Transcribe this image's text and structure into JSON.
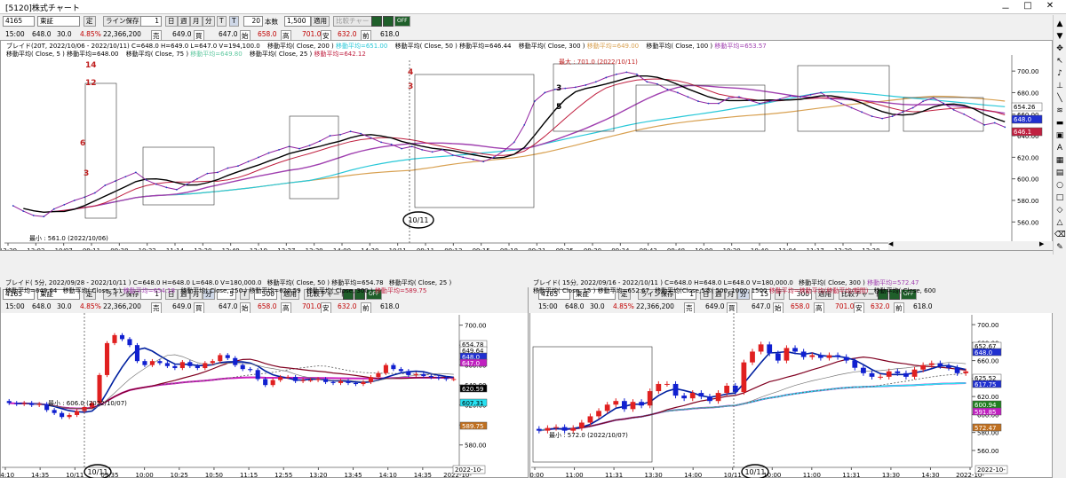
{
  "window": {
    "title": "[5120]株式チャート",
    "minimize": "－",
    "restore": "□",
    "close": "✕"
  },
  "toolbar_icons": [
    "gear-icon",
    "scale-icon",
    "off-icon"
  ],
  "top": {
    "toolbar": {
      "code": "4165",
      "market": "東証",
      "period": "定",
      "line_save": "ライン保存",
      "num1": "1",
      "unit1": "日",
      "unit2": "週",
      "unit3": "月",
      "unit4": "分",
      "btn_t1": "T",
      "btn_t2": "T",
      "bars": "20",
      "candles": "本数",
      "count": "1,500",
      "apply": "適用",
      "compare": "比較チャート",
      "time": "15:00",
      "price": "648.0",
      "diff": "30.0",
      "pct": "4.85%",
      "volume": "22,366,200",
      "sell_lbl": "売",
      "ask": "649.0",
      "buy_lbl": "買",
      "open": "647.0",
      "open_lbl": "始",
      "high": "658.0",
      "high_lbl": "高",
      "low": "701.0",
      "low_lbl": "安",
      "pclose": "632.0",
      "prev_lbl": "前",
      "last": "618.0"
    },
    "legend": [
      "ブレイド(20T, 2022/10/06 - 2022/10/11) C=648.0 H=649.0 L=647.0 V=194,100.0",
      "移動平均( Close, 200 )",
      "移動平均=651.00",
      "移動平均( Close, 50 )",
      "移動平均=646.44",
      "移動平均( Close, 300 )",
      "移動平均=649.00",
      "移動平均( Close, 100 )",
      "移動平均=653.57",
      "移動平均( Close, 5 )",
      "移動平均=648.00",
      "移動平均( Close, 75 )",
      "移動平均=649.80",
      "移動平均( Close, 25 )",
      "移動平均=642.12"
    ],
    "annot_max": "最大 : 701.0 (2022/10/11)",
    "annot_min": "最小 : 561.0 (2022/10/06)",
    "wave_labels": [
      "14",
      "12",
      "6",
      "3",
      "4",
      "3",
      "3",
      "5"
    ],
    "price_boxes": [
      "654.26",
      "648.0",
      "646.1"
    ],
    "date_marker": "10/11",
    "scroll_arrows": [
      "◀",
      "▶"
    ]
  },
  "bottom_left": {
    "toolbar": {
      "code": "4165",
      "market": "東証",
      "period": "定",
      "line_save": "ライン保存",
      "num1": "1",
      "unit1": "日",
      "unit2": "週",
      "unit3": "月",
      "unit4": "分",
      "unit5": "5",
      "btn_t": "T",
      "bars": "500",
      "apply": "適用",
      "compare": "比較チャート",
      "time": "15:00",
      "price": "648.0",
      "diff": "30.0",
      "pct": "4.85%",
      "volume": "22,366,200",
      "sell_lbl": "売",
      "ask": "649.0",
      "buy_lbl": "買",
      "open": "647.0",
      "open_lbl": "始",
      "high": "658.0",
      "high_lbl": "高",
      "low": "701.0",
      "low_lbl": "安",
      "pclose": "632.0",
      "prev_lbl": "前",
      "last": "618.0"
    },
    "legend": [
      "ブレイド( 5分, 2022/09/28 - 2022/10/11 ) C=648.0 H=648.0 L=648.0 V=180,000.0",
      "移動平均( Close, 50 )",
      "移動平均=654.78",
      "移動平均( Close, 25 )",
      "移動平均=649.64",
      "移動平均( Close, 5 )",
      "移動平均=654.18",
      "移動平均( Close, 150 )",
      "移動平均=620.59",
      "移動平均( Close, 300 )",
      "移動平均=589.75"
    ],
    "annot_min": "最小 : 606.0 (2022/10/07)",
    "price_boxes": [
      "654.78",
      "649.64",
      "648.0",
      "647.0",
      "620.59",
      "607.31",
      "589.75"
    ],
    "date_marker": "10/11",
    "date_end": "2022-10-"
  },
  "bottom_right": {
    "toolbar": {
      "code": "4165",
      "market": "東証",
      "period": "定",
      "line_save": "ライン保存",
      "num1": "1",
      "unit1": "日",
      "unit2": "週",
      "unit3": "月",
      "unit4": "分",
      "unit5": "15",
      "btn_t": "T",
      "bars": "300",
      "apply": "適用",
      "compare": "比較チャート",
      "time": "15:00",
      "price": "648.0",
      "diff": "30.0",
      "pct": "4.85%",
      "volume": "22,366,200",
      "sell_lbl": "売",
      "ask": "649.0",
      "buy_lbl": "買",
      "open": "647.0",
      "open_lbl": "始",
      "high": "658.0",
      "high_lbl": "高",
      "low": "701.0",
      "low_lbl": "安",
      "pclose": "632.0",
      "prev_lbl": "前",
      "last": "618.0"
    },
    "legend": [
      "ブレイド( 15分, 2022/09/16 - 2022/10/11 ) C=648.0 H=648.0 L=648.0 V=180,000.0",
      "移動平均( Close, 300 )",
      "移動平均=572.47",
      "移動平均( Close, 15 )",
      "移動平均=652.67",
      "移動平均(Close,5本( 500, 1000, 1500",
      "移動平均=移動平均(移動平均/期間)",
      "移動平均( Close, 600"
    ],
    "annot_min": "最小 : 572.0 (2022/10/07)",
    "price_boxes": [
      "652.67",
      "648.0",
      "625.52",
      "617.75",
      "600.94",
      "591.85",
      "572.47"
    ],
    "date_marker": "10/11",
    "date_end": "2022-10-"
  },
  "chart_data": [
    {
      "type": "candlestick",
      "name": "top",
      "title": "ブレイド(20T, 2022/10/06 - 2022/10/11)",
      "ylim": [
        552,
        710
      ],
      "yticks": [
        560,
        580,
        600,
        620,
        640,
        660,
        680,
        700
      ],
      "xticks": [
        "12:39",
        "13:02",
        "10/07",
        "09:11",
        "09:38",
        "10:32",
        "11:14",
        "12:30",
        "12:49",
        "13:19",
        "13:27",
        "13:39",
        "14:00",
        "14:30",
        "10/11",
        "09:11",
        "09:13",
        "09:15",
        "09:18",
        "09:21",
        "09:25",
        "09:30",
        "09:34",
        "08:43",
        "09:48",
        "10:00",
        "10:20",
        "10:40",
        "11:04",
        "11:17",
        "12:30",
        "12:38",
        "13:00",
        "13:46",
        "14:05",
        "14:25",
        "14"
      ],
      "close": [
        575,
        570,
        566,
        565,
        572,
        576,
        580,
        583,
        587,
        594,
        598,
        602,
        606,
        599,
        595,
        592,
        590,
        595,
        600,
        605,
        606,
        610,
        612,
        616,
        620,
        624,
        627,
        630,
        628,
        631,
        635,
        640,
        641,
        644,
        642,
        638,
        634,
        632,
        628,
        630,
        627,
        625,
        627,
        622,
        620,
        618,
        616,
        620,
        626,
        634,
        650,
        672,
        680,
        683,
        684,
        685,
        687,
        690,
        694,
        697,
        699,
        697,
        690,
        688,
        683,
        680,
        676,
        672,
        670,
        670,
        675,
        676,
        673,
        670,
        672,
        674,
        677,
        676,
        678,
        680,
        674,
        670,
        666,
        662,
        658,
        656,
        658,
        662,
        666,
        672,
        675,
        670,
        664,
        660,
        655,
        650,
        652,
        648
      ]
    },
    {
      "type": "candlestick",
      "name": "bottom_left",
      "title": "ブレイド( 5分, 2022/09/28 - 2022/10/11 )",
      "ylim": [
        570,
        705
      ],
      "yticks": [
        580,
        600,
        620,
        640,
        660,
        680,
        700
      ],
      "xticks": [
        "14:10",
        "14:35",
        "10/11",
        "09:35",
        "10:00",
        "10:25",
        "10:50",
        "11:15",
        "12:55",
        "13:20",
        "13:45",
        "14:10",
        "14:35",
        "2022-10-"
      ],
      "close": [
        622,
        621,
        622,
        620,
        621,
        615,
        612,
        608,
        610,
        614,
        618,
        622,
        650,
        682,
        690,
        686,
        680,
        664,
        660,
        664,
        662,
        659,
        657,
        663,
        659,
        657,
        662,
        664,
        670,
        667,
        660,
        656,
        655,
        646,
        640,
        645,
        648,
        648,
        644,
        645,
        645,
        646,
        643,
        642,
        644,
        642,
        641,
        643,
        648,
        652,
        660,
        656,
        654,
        650,
        651,
        649,
        648,
        647,
        646,
        646
      ]
    },
    {
      "type": "candlestick",
      "name": "bottom_right",
      "title": "ブレイド( 15分, 2022/09/16 - 2022/10/11 )",
      "ylim": [
        555,
        705
      ],
      "yticks": [
        560,
        580,
        600,
        620,
        640,
        660,
        680,
        700
      ],
      "xticks": [
        "10:00",
        "11:00",
        "11:31",
        "13:30",
        "14:00",
        "10/11",
        "10:00",
        "11:00",
        "11:31",
        "13:30",
        "14:30",
        "2022-10-"
      ],
      "close": [
        582,
        585,
        586,
        582,
        585,
        591,
        598,
        604,
        611,
        615,
        606,
        614,
        610,
        626,
        634,
        634,
        621,
        618,
        624,
        620,
        615,
        624,
        632,
        625,
        658,
        670,
        678,
        668,
        660,
        674,
        670,
        664,
        666,
        663,
        666,
        664,
        660,
        652,
        646,
        642,
        642,
        648,
        646,
        642,
        650,
        655,
        657,
        654,
        652,
        646,
        648
      ]
    }
  ]
}
